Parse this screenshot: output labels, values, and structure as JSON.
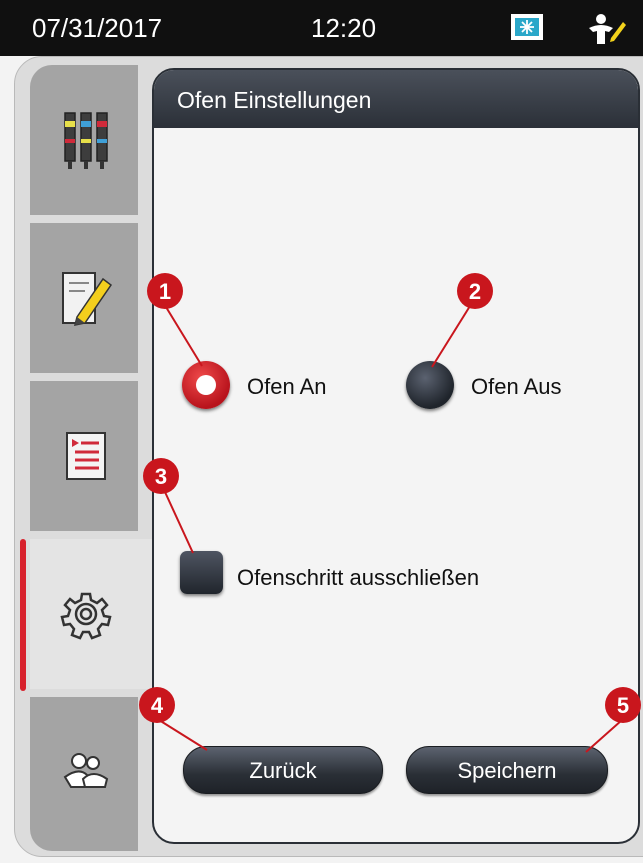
{
  "statusbar": {
    "date": "07/31/2017",
    "time": "12:20",
    "icons": [
      "oven-status-icon",
      "user-icon"
    ]
  },
  "sidebar": {
    "tabs": [
      {
        "name": "reagents",
        "icon": "reagent-bottles-icon"
      },
      {
        "name": "programs",
        "icon": "edit-pencil-icon"
      },
      {
        "name": "protocols",
        "icon": "protocol-list-icon"
      },
      {
        "name": "settings",
        "icon": "gear-icon",
        "active": true
      },
      {
        "name": "user",
        "icon": "users-icon"
      }
    ]
  },
  "panel": {
    "title": "Ofen Einstellungen",
    "oven_on_label": "Ofen An",
    "oven_off_label": "Ofen Aus",
    "oven_selected": "on",
    "exclude_label": "Ofenschritt ausschließen",
    "exclude_checked": false,
    "back_label": "Zurück",
    "save_label": "Speichern"
  },
  "callouts": [
    "1",
    "2",
    "3",
    "4",
    "5"
  ],
  "colors": {
    "accent": "#c9161d",
    "panel_header": "#2b3038"
  }
}
